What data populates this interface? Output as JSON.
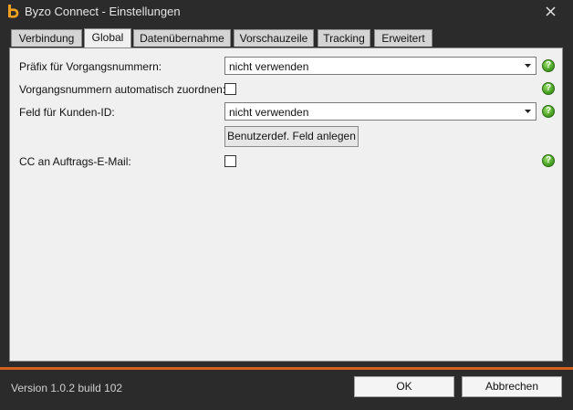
{
  "window": {
    "title": "Byzo Connect - Einstellungen",
    "brand_color": "#f0a020",
    "accent_color": "#d2601a"
  },
  "tabs": [
    {
      "label": "Verbindung",
      "active": false
    },
    {
      "label": "Global",
      "active": true
    },
    {
      "label": "Datenübernahme",
      "active": false
    },
    {
      "label": "Vorschauzeile",
      "active": false
    },
    {
      "label": "Tracking",
      "active": false
    },
    {
      "label": "Erweitert",
      "active": false
    }
  ],
  "settings": {
    "prefix": {
      "label": "Präfix für Vorgangsnummern:",
      "value": "nicht verwenden"
    },
    "auto_assign": {
      "label": "Vorgangsnummern automatisch zuordnen:",
      "checked": false
    },
    "customer_field": {
      "label": "Feld für Kunden-ID:",
      "value": "nicht verwenden"
    },
    "create_field_button": "Benutzerdef. Feld anlegen",
    "cc_email": {
      "label": "CC an Auftrags-E-Mail:",
      "checked": false
    },
    "help_glyph": "?"
  },
  "footer": {
    "version": "Version 1.0.2 build 102",
    "ok_label": "OK",
    "cancel_label": "Abbrechen"
  }
}
